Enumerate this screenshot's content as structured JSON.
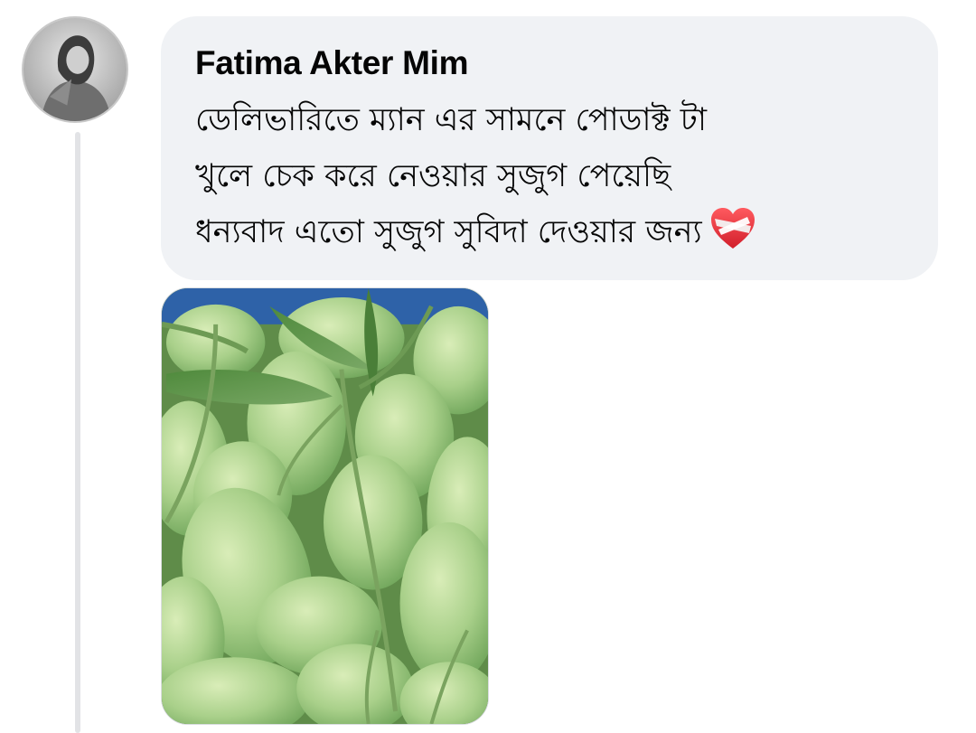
{
  "comment": {
    "author": "Fatima Akter Mim",
    "lines": [
      "ডেলিভারিতে ম্যান এর সামনে পোডাক্ট টা",
      "খুলে চেক করে নেওয়ার সুজুগ পেয়েছি",
      "ধন্যবাদ এতো সুজুগ সুবিদা দেওয়ার জন্য"
    ],
    "emoji": "mending-heart-icon"
  },
  "attachment": {
    "subject": "mango-photo"
  },
  "colors": {
    "bubble": "#f0f2f5",
    "thread_line": "#e2e3e6",
    "text": "#050505",
    "heart": "#e8323b"
  }
}
